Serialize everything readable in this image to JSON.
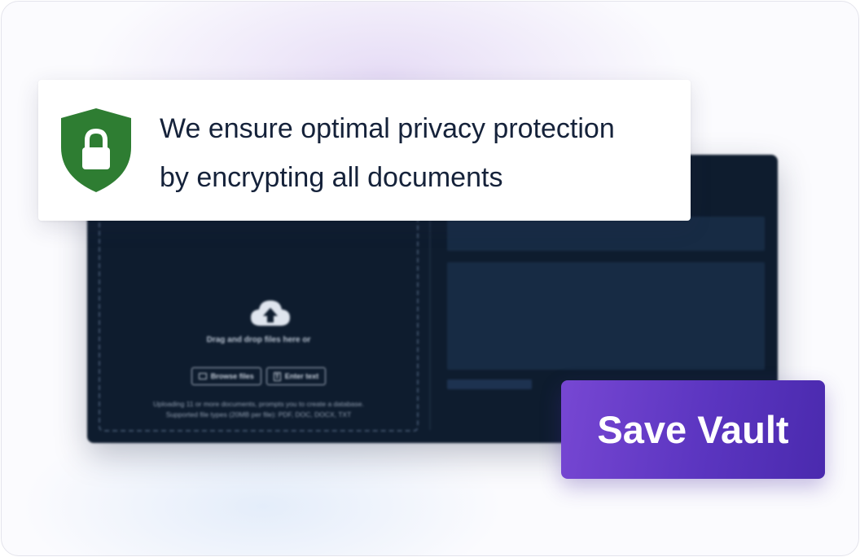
{
  "privacy_notice": {
    "line1": "We ensure optimal privacy protection",
    "line2": "by encrypting all documents",
    "icon": "shield-lock-icon",
    "icon_color": "#2e7d32"
  },
  "upload_panel": {
    "drop_text": "Drag and drop files here or",
    "browse_label": "Browse files",
    "enter_text_label": "Enter text",
    "note_line1": "Uploading 11 or more documents, prompts you to create a database.",
    "note_line2": "Supported file types (20MB per file): PDF, DOC, DOCX, TXT",
    "background": "#0e1c2e"
  },
  "save_button": {
    "label": "Save Vault",
    "color": "#6a3fcf"
  }
}
